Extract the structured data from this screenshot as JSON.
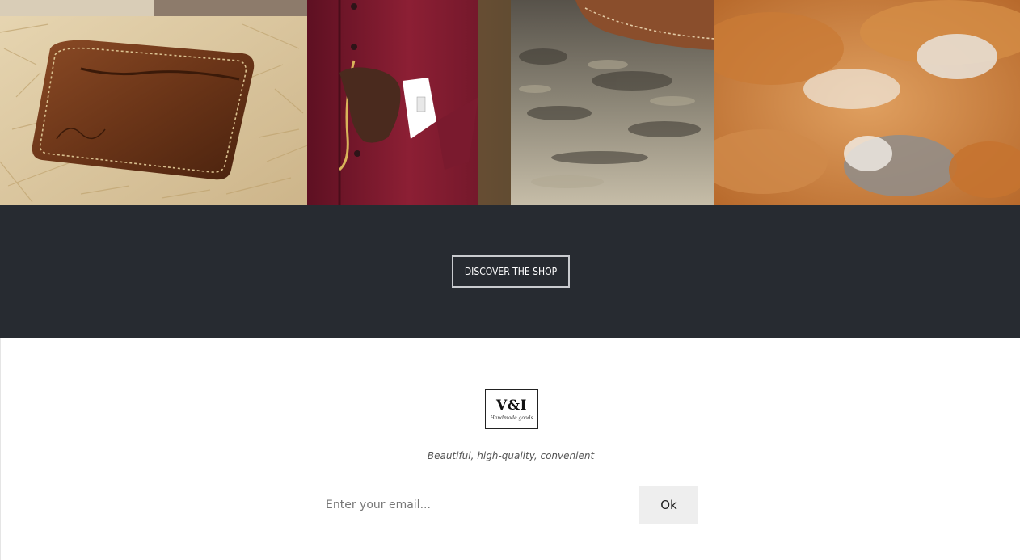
{
  "gallery": {
    "images": [
      {
        "name": "leather-card-wallet-photo"
      },
      {
        "name": "burgundy-suit-pocket-watch-photo"
      },
      {
        "name": "leather-and-stone-texture-photo"
      },
      {
        "name": "fox-fur-texture-photo"
      }
    ]
  },
  "shop": {
    "button_label": "DISCOVER THE SHOP",
    "background": "#272b31"
  },
  "footer": {
    "logo": {
      "main": "V&I",
      "sub": "Handmade goods"
    },
    "tagline": "Beautiful, high-quality, convenient",
    "email_placeholder": "Enter your email...",
    "submit_label": "Ok"
  }
}
